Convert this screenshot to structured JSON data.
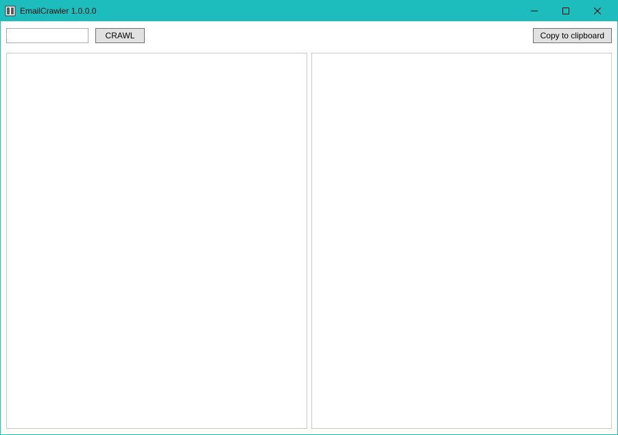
{
  "window": {
    "title": "EmailCrawler 1.0.0.0"
  },
  "toolbar": {
    "url_value": "",
    "crawl_label": "CRAWL",
    "copy_label": "Copy to clipboard"
  },
  "panels": {
    "left_content": "",
    "right_content": ""
  }
}
